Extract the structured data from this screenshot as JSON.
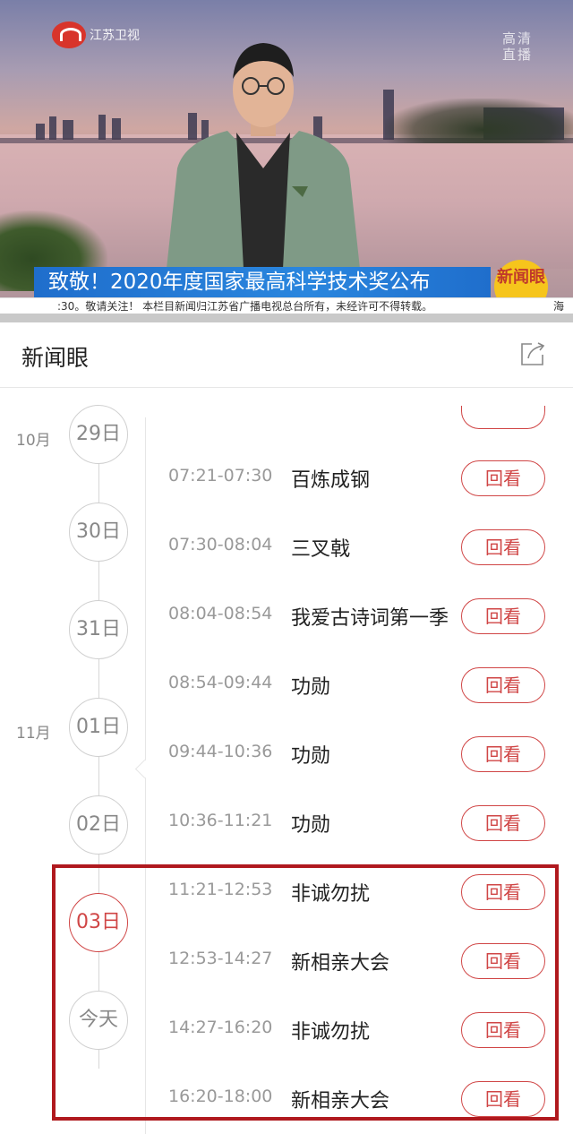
{
  "video": {
    "channel_logo_text": "江苏卫视",
    "hd_tag": "高清直播",
    "headline": "致敬！2020年度国家最高科学技术奖公布",
    "ticker_left": ":30。敬请关注！  本栏目新闻归江苏省广播电视总台所有，未经许可不得转载。",
    "ticker_right": "海",
    "show_badge": "新闻眼"
  },
  "header": {
    "title": "新闻眼",
    "share_icon": "share-icon"
  },
  "timeline": {
    "months": [
      "10月",
      "11月"
    ],
    "days": [
      {
        "label": "29日",
        "active": false
      },
      {
        "label": "30日",
        "active": false
      },
      {
        "label": "31日",
        "active": false
      },
      {
        "label": "01日",
        "active": false
      },
      {
        "label": "02日",
        "active": false
      },
      {
        "label": "03日",
        "active": true
      },
      {
        "label": "今天",
        "active": false
      }
    ]
  },
  "programs": [
    {
      "time": "07:21-07:30",
      "name": "百炼成钢",
      "action": "回看"
    },
    {
      "time": "07:30-08:04",
      "name": "三叉戟",
      "action": "回看"
    },
    {
      "time": "08:04-08:54",
      "name": "我爱古诗词第一季",
      "action": "回看"
    },
    {
      "time": "08:54-09:44",
      "name": "功勋",
      "action": "回看"
    },
    {
      "time": "09:44-10:36",
      "name": "功勋",
      "action": "回看"
    },
    {
      "time": "10:36-11:21",
      "name": "功勋",
      "action": "回看"
    },
    {
      "time": "11:21-12:53",
      "name": "非诚勿扰",
      "action": "回看"
    },
    {
      "time": "12:53-14:27",
      "name": "新相亲大会",
      "action": "回看"
    },
    {
      "time": "14:27-16:20",
      "name": "非诚勿扰",
      "action": "回看"
    },
    {
      "time": "16:20-18:00",
      "name": "新相亲大会",
      "action": "回看"
    }
  ],
  "colors": {
    "accent": "#d04646",
    "highlight_box": "#b0191e",
    "headline_bar": "#1f6ecc"
  }
}
